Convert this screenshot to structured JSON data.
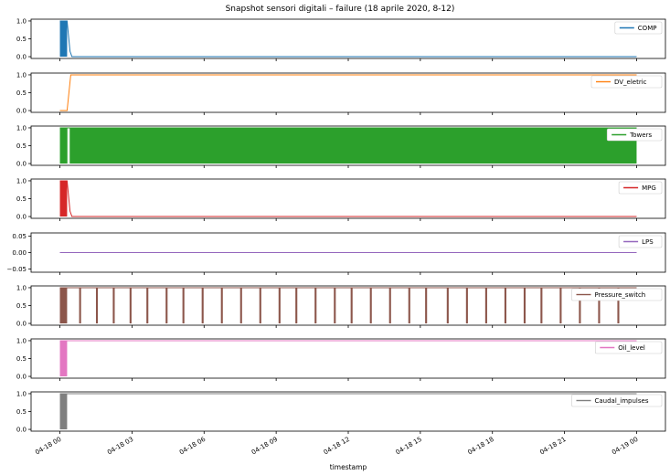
{
  "chart_data": {
    "type": "line",
    "title": "Snapshot sensori digitali – failure (18 aprile 2020, 8-12)",
    "xlabel": "timestamp",
    "x_tick_labels": [
      "04-18 00",
      "04-18 03",
      "04-18 06",
      "04-18 09",
      "04-18 12",
      "04-18 15",
      "04-18 18",
      "04-18 21",
      "04-19 00"
    ],
    "xlim_hours": [
      -1.2,
      25.2
    ],
    "x_unit": "hours since 04-18 00",
    "legend_position": "right",
    "grid": false,
    "panels": [
      {
        "name": "COMP",
        "color": "#1f77b4",
        "ylim": [
          -0.05,
          1.05
        ],
        "yticks": [
          "0.0",
          "0.5",
          "1.0"
        ],
        "ytick_values": [
          0,
          0.5,
          1
        ],
        "points": [
          [
            0,
            1
          ],
          [
            0.3,
            1
          ],
          [
            0.42,
            0.15
          ],
          [
            0.5,
            0
          ],
          [
            24,
            0
          ]
        ],
        "fill_to": 0.3
      },
      {
        "name": "DV_eletric",
        "color": "#ff7f0e",
        "ylim": [
          -0.05,
          1.05
        ],
        "yticks": [
          "0.0",
          "0.5",
          "1.0"
        ],
        "ytick_values": [
          0,
          0.5,
          1
        ],
        "points": [
          [
            0,
            0
          ],
          [
            0.3,
            0
          ],
          [
            0.45,
            1
          ],
          [
            24,
            1
          ]
        ]
      },
      {
        "name": "Towers",
        "color": "#2ca02c",
        "ylim": [
          -0.05,
          1.05
        ],
        "yticks": [
          "0.0",
          "0.5",
          "1.0"
        ],
        "ytick_values": [
          0,
          0.5,
          1
        ],
        "points": [
          [
            0,
            1
          ],
          [
            24,
            1
          ]
        ],
        "fill_to": 24,
        "gap": 0.35
      },
      {
        "name": "MPG",
        "color": "#d62728",
        "ylim": [
          -0.05,
          1.05
        ],
        "yticks": [
          "0.0",
          "0.5",
          "1.0"
        ],
        "ytick_values": [
          0,
          0.5,
          1
        ],
        "points": [
          [
            0,
            1
          ],
          [
            0.3,
            1
          ],
          [
            0.42,
            0.15
          ],
          [
            0.5,
            0
          ],
          [
            24,
            0
          ]
        ],
        "fill_to": 0.3
      },
      {
        "name": "LPS",
        "color": "#9467bd",
        "ylim": [
          -0.06,
          0.06
        ],
        "yticks": [
          "−0.05",
          "0.00",
          "0.05"
        ],
        "ytick_values": [
          -0.05,
          0,
          0.05
        ],
        "points": [
          [
            0,
            0
          ],
          [
            24,
            0
          ]
        ]
      },
      {
        "name": "Pressure_switch",
        "color": "#8c564b",
        "ylim": [
          -0.05,
          1.05
        ],
        "yticks": [
          "0.0",
          "0.5",
          "1.0"
        ],
        "ytick_values": [
          0,
          0.5,
          1
        ],
        "points": [
          [
            0,
            1
          ],
          [
            24,
            1
          ]
        ],
        "pulses_hours": [
          0.0,
          0.8,
          1.5,
          2.2,
          2.9,
          3.6,
          4.4,
          5.1,
          5.9,
          6.7,
          7.5,
          8.3,
          9.1,
          9.8,
          10.6,
          11.4,
          12.1,
          12.9,
          13.7,
          14.5,
          15.2,
          16.1,
          16.9,
          17.7,
          18.5,
          19.3,
          20.0,
          20.8,
          21.6,
          22.4,
          23.2
        ],
        "pulse_width": 0.08,
        "initial_block": [
          0,
          0.3
        ]
      },
      {
        "name": "Oil_level",
        "color": "#e377c2",
        "ylim": [
          -0.05,
          1.05
        ],
        "yticks": [
          "0.0",
          "0.5",
          "1.0"
        ],
        "ytick_values": [
          0,
          0.5,
          1
        ],
        "points": [
          [
            0,
            1
          ],
          [
            24,
            1
          ]
        ],
        "fill_to": 0.3
      },
      {
        "name": "Caudal_impulses",
        "color": "#7f7f7f",
        "ylim": [
          -0.05,
          1.05
        ],
        "yticks": [
          "0.0",
          "0.5",
          "1.0"
        ],
        "ytick_values": [
          0,
          0.5,
          1
        ],
        "points": [
          [
            0,
            1
          ],
          [
            24,
            1
          ]
        ],
        "fill_to": 0.3
      }
    ]
  }
}
